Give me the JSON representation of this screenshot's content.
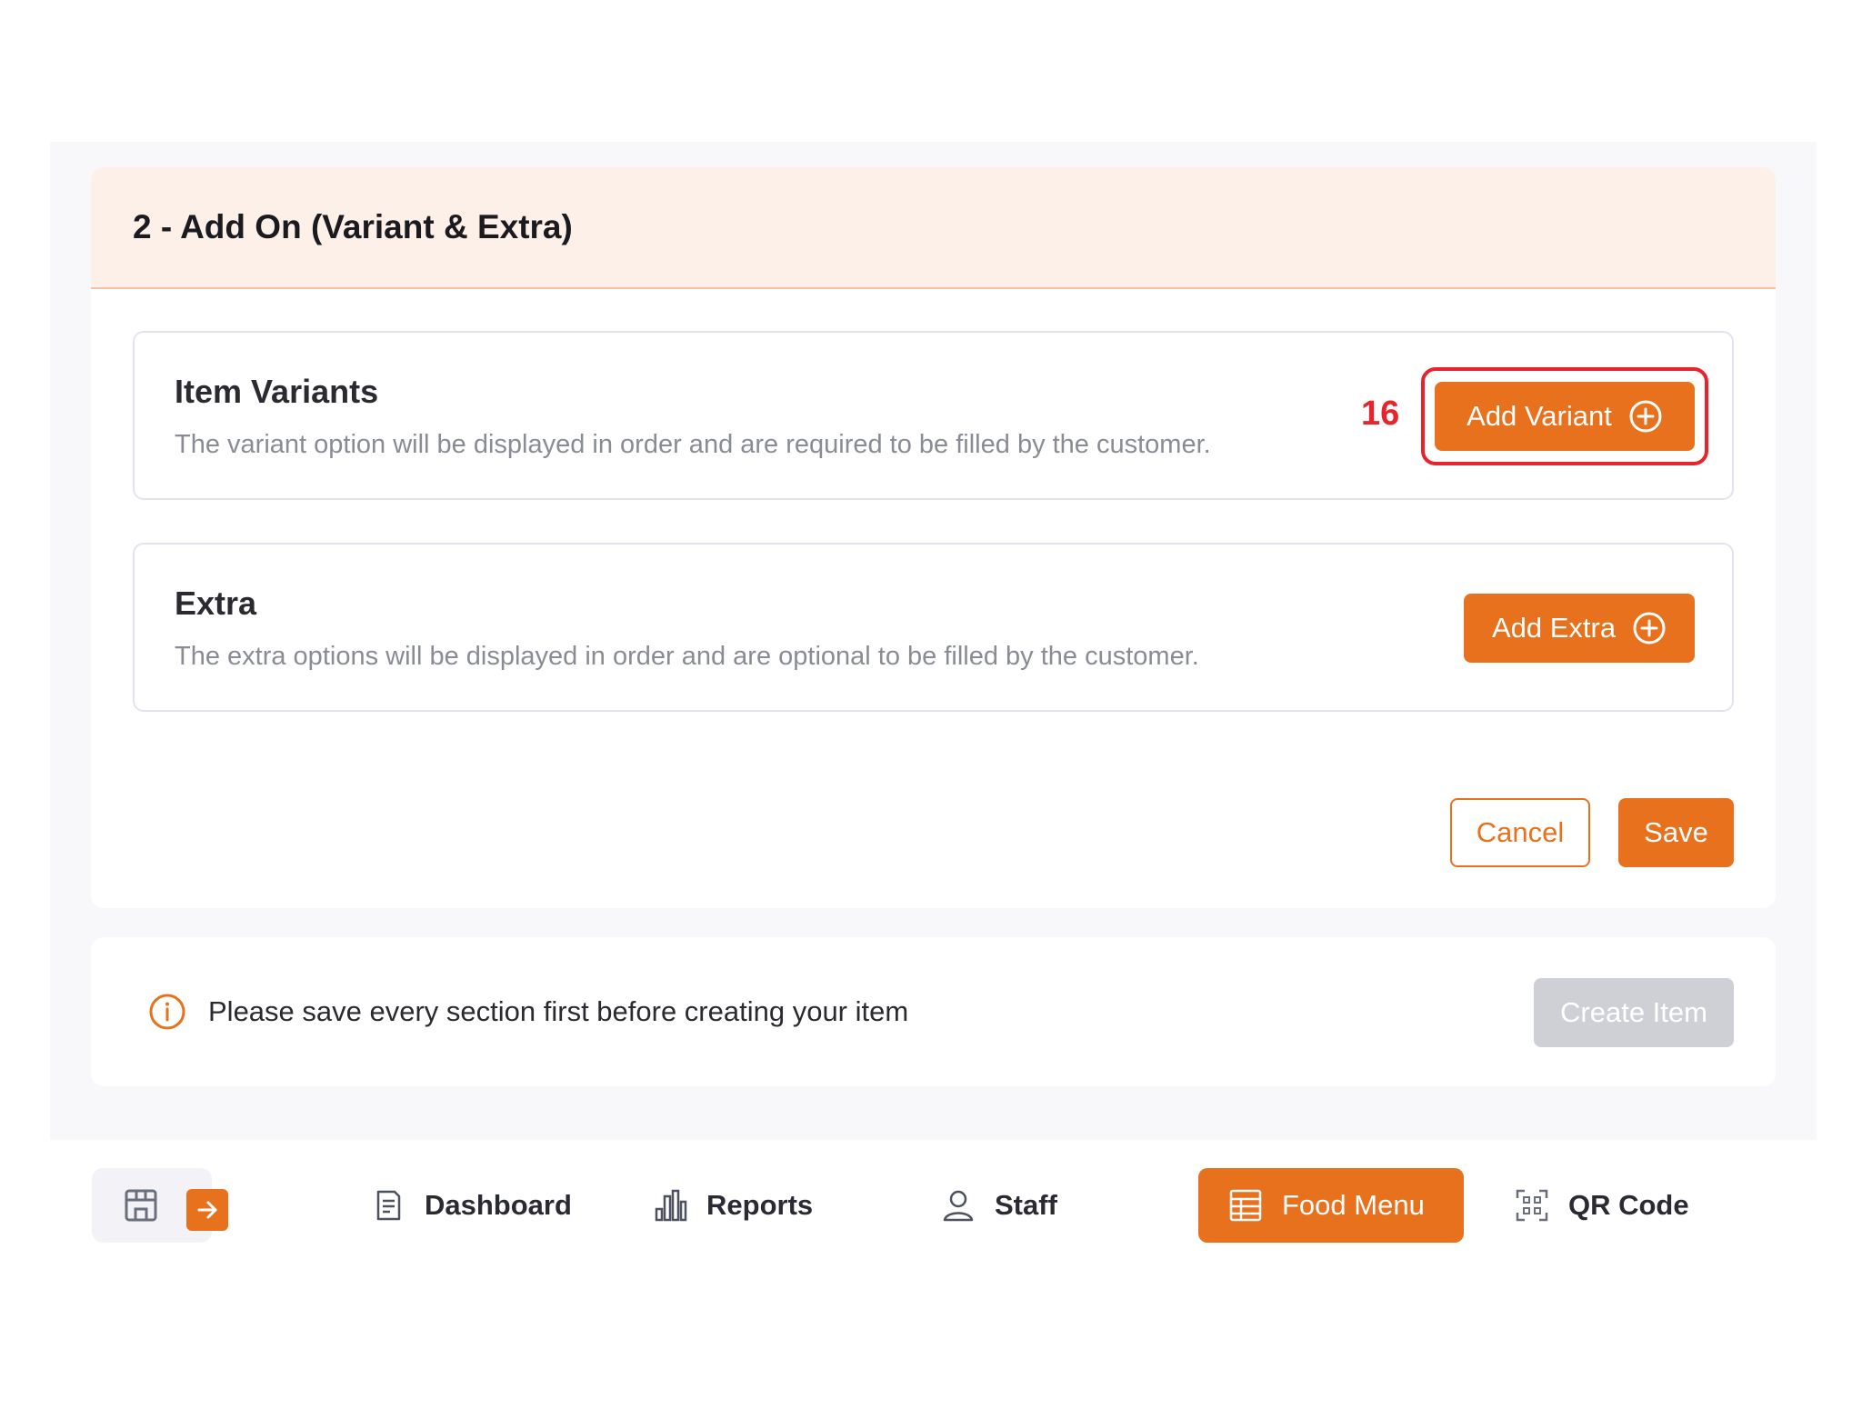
{
  "section": {
    "title": "2 - Add On (Variant & Extra)"
  },
  "variants": {
    "title": "Item Variants",
    "description": "The variant option will be displayed in order and are required to be filled by the customer.",
    "button_label": "Add Variant",
    "step_number": "16"
  },
  "extra": {
    "title": "Extra",
    "description": "The extra options will be displayed in order and are optional to be filled by the customer.",
    "button_label": "Add Extra"
  },
  "actions": {
    "cancel_label": "Cancel",
    "save_label": "Save"
  },
  "notice": {
    "text": "Please save every section first before creating your item",
    "create_label": "Create Item"
  },
  "nav": {
    "items": [
      {
        "label": "Dashboard",
        "icon": "document-icon"
      },
      {
        "label": "Reports",
        "icon": "bar-chart-icon"
      },
      {
        "label": "Staff",
        "icon": "person-icon"
      },
      {
        "label": "Food Menu",
        "icon": "menu-grid-icon",
        "active": true
      },
      {
        "label": "QR Code",
        "icon": "qr-code-icon"
      }
    ]
  },
  "colors": {
    "accent": "#e8711d",
    "header_bg": "#fdf0e9",
    "highlight": "#e8232c",
    "disabled": "#cfcfd6"
  }
}
